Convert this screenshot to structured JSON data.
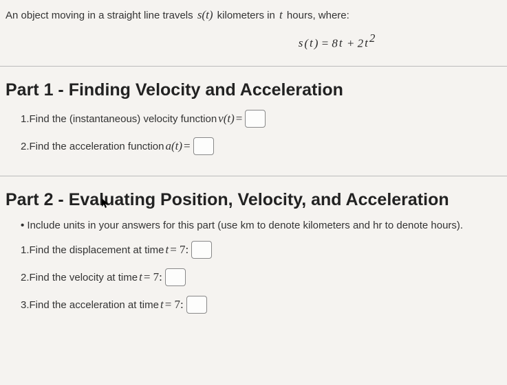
{
  "intro": {
    "prefix": "An object moving in a straight line travels ",
    "func": "s(t)",
    "mid": " kilometers in ",
    "tvar": "t",
    "suffix": " hours, where:"
  },
  "equation": "s(t) = 8t + 2t²",
  "part1": {
    "heading": "Part 1 - Finding Velocity and Acceleration",
    "q1": {
      "num": "1. ",
      "text": "Find the (instantaneous) velocity function ",
      "func": "v(t)",
      "eq": " = "
    },
    "q2": {
      "num": "2. ",
      "text": "Find the acceleration function ",
      "func": "a(t)",
      "eq": " = "
    }
  },
  "part2": {
    "heading": "Part 2 - Evaluating Position, Velocity, and Acceleration",
    "note": "Include units in your answers for this part (use km to denote kilometers and hr to denote hours).",
    "q1": {
      "num": "1. ",
      "text": "Find the displacement at time ",
      "tvar": "t",
      "eq": " = 7: "
    },
    "q2": {
      "num": "2. ",
      "text": "Find the velocity at time ",
      "tvar": "t",
      "eq": " = 7: "
    },
    "q3": {
      "num": "3. ",
      "text": "Find the acceleration at time ",
      "tvar": "t",
      "eq": " = 7: "
    }
  }
}
